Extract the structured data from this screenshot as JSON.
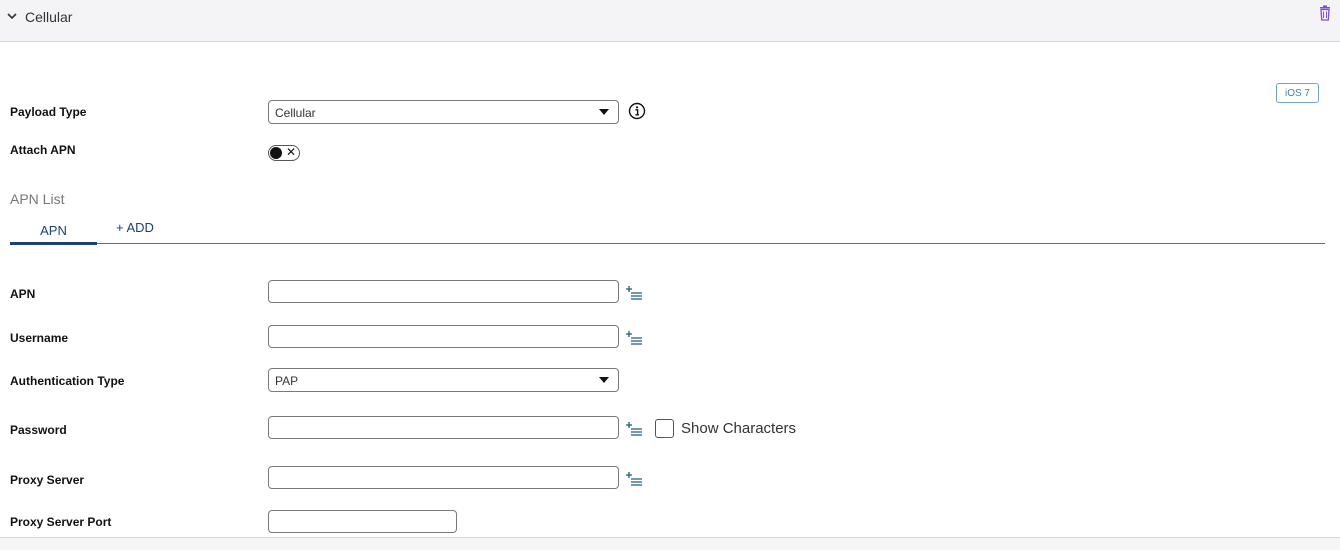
{
  "section": {
    "title": "Cellular"
  },
  "badge": {
    "text": "iOS 7"
  },
  "payload_type": {
    "label": "Payload Type",
    "value": "Cellular"
  },
  "attach_apn": {
    "label": "Attach APN",
    "state": "off"
  },
  "apn_list": {
    "title": "APN List",
    "tabs": [
      {
        "label": "APN",
        "active": true
      }
    ],
    "add_label": "+ ADD"
  },
  "fields": {
    "apn": {
      "label": "APN",
      "value": ""
    },
    "username": {
      "label": "Username",
      "value": ""
    },
    "auth_type": {
      "label": "Authentication Type",
      "value": "PAP"
    },
    "password": {
      "label": "Password",
      "value": "",
      "show_characters_label": "Show Characters"
    },
    "proxy_server": {
      "label": "Proxy Server",
      "value": ""
    },
    "proxy_server_port": {
      "label": "Proxy Server Port",
      "value": ""
    }
  },
  "icons": {
    "collapse": "chevron-down-icon",
    "delete": "trash-icon",
    "info": "info-icon",
    "variables": "insert-variable-icon"
  },
  "colors": {
    "accent": "#1c3f75",
    "badge": "#4a7ea3",
    "delete": "#7b4fd6"
  }
}
